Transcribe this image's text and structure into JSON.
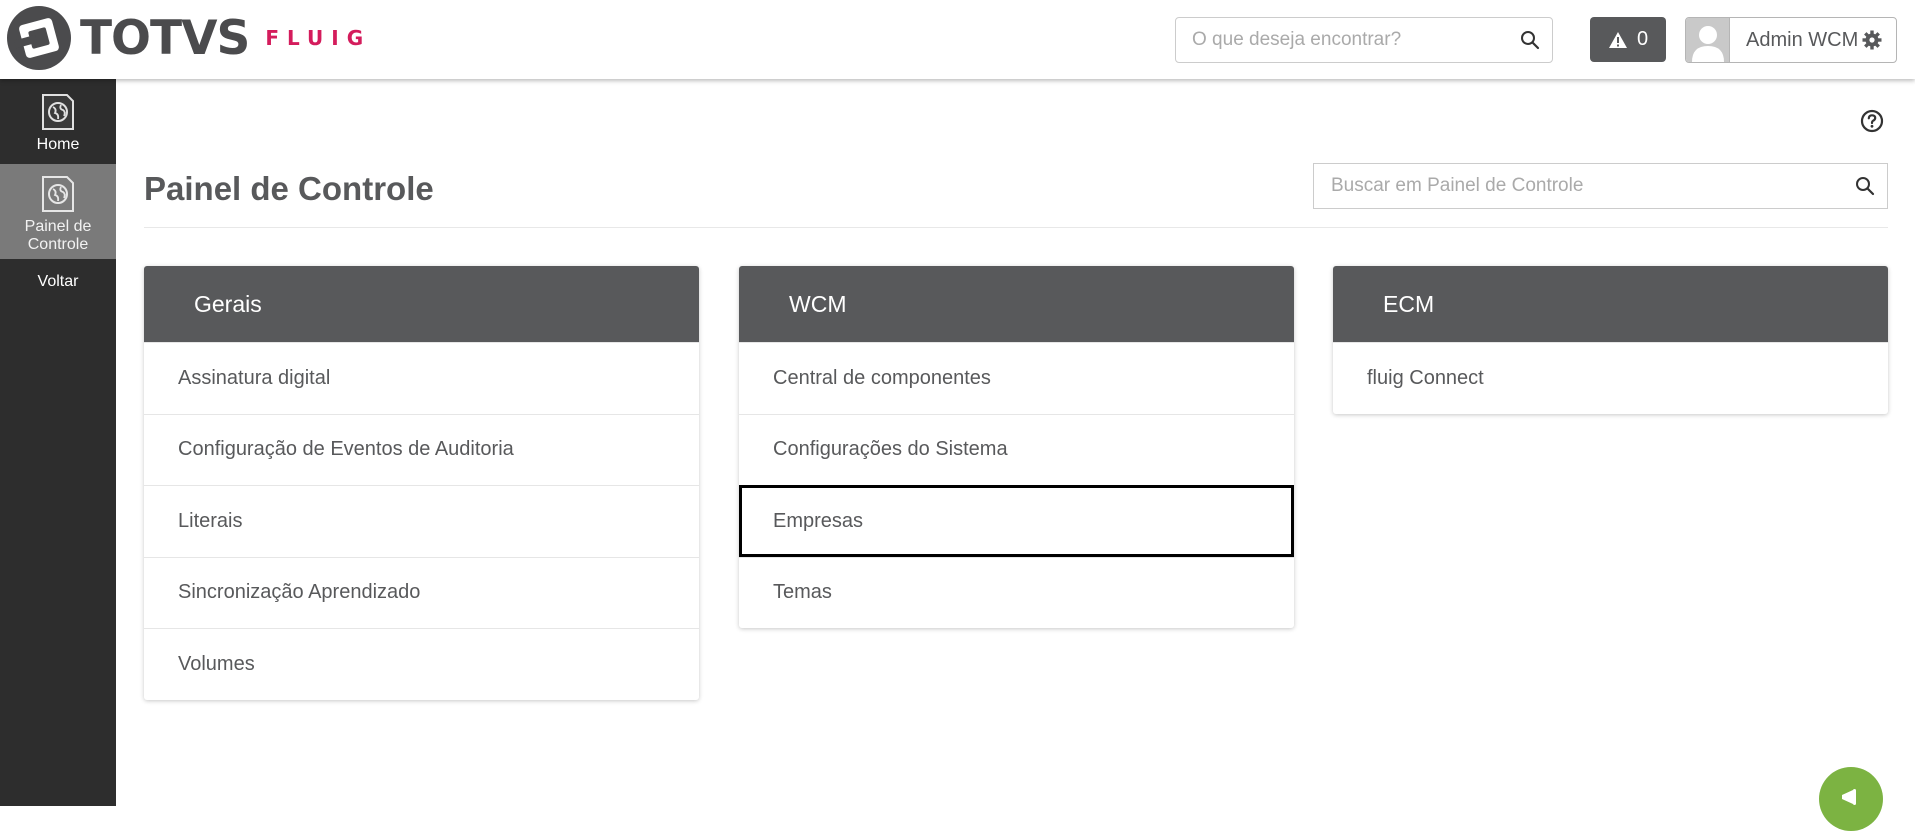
{
  "header": {
    "logo_text": "TOTVS",
    "logo_sub": "FLUIG",
    "search_placeholder": "O que deseja encontrar?",
    "alerts_count": "0",
    "user_name": "Admin WCM"
  },
  "sidebar": {
    "items": [
      {
        "label": "Home",
        "icon": "globe-doc-icon"
      },
      {
        "label": "Painel de Controle",
        "icon": "globe-doc-icon"
      },
      {
        "label": "Voltar"
      }
    ]
  },
  "page": {
    "title": "Painel de Controle",
    "search_placeholder": "Buscar em Painel de Controle"
  },
  "cards": [
    {
      "title": "Gerais",
      "items": [
        "Assinatura digital",
        "Configuração de Eventos de Auditoria",
        "Literais",
        "Sincronização Aprendizado",
        "Volumes"
      ]
    },
    {
      "title": "WCM",
      "items": [
        "Central de componentes",
        "Configurações do Sistema",
        "Empresas",
        "Temas"
      ],
      "focused_item": "Empresas"
    },
    {
      "title": "ECM",
      "items": [
        "fluig Connect"
      ]
    }
  ],
  "colors": {
    "sidebar_bg": "#2d2d2d",
    "sidebar_active": "#7a7a7a",
    "card_header": "#58595b",
    "brand_pink": "#d41c5c",
    "fab_green": "#7cb342"
  }
}
